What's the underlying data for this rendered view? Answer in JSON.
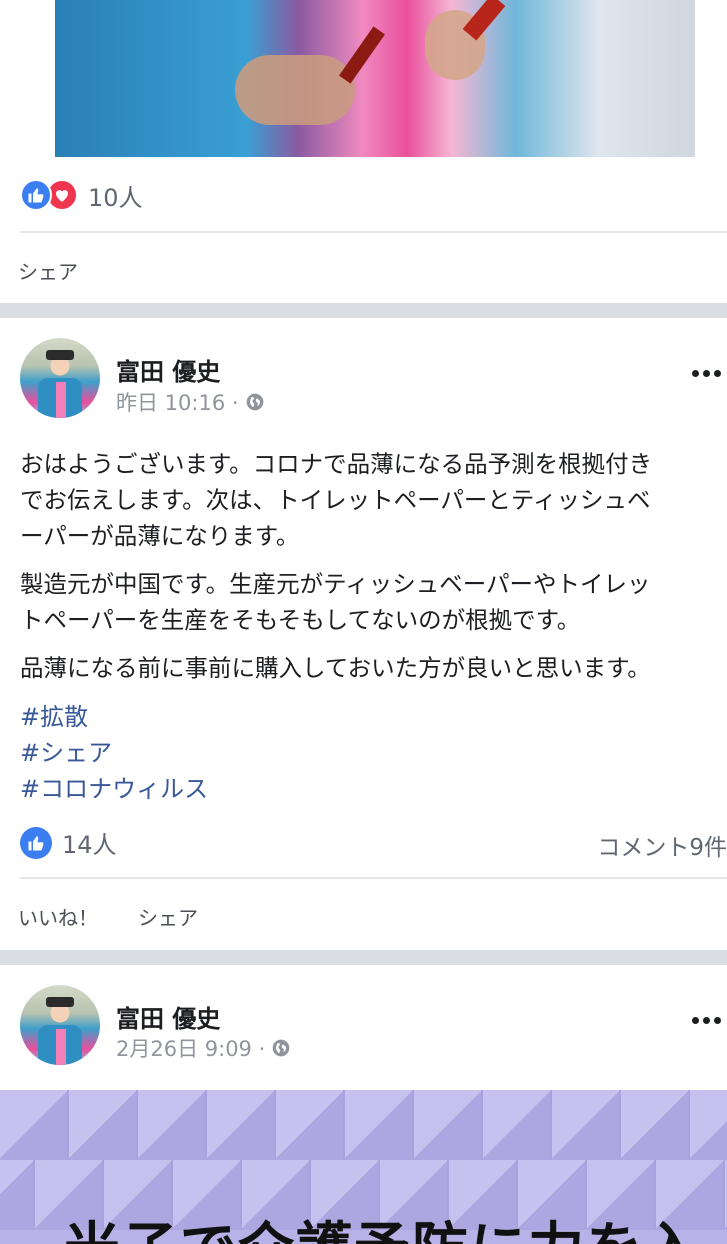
{
  "post_prev": {
    "reactions": [
      "like-icon",
      "love-icon"
    ],
    "reaction_count": "10人",
    "actions": {
      "share_label": "シェア"
    }
  },
  "post_main": {
    "author": "富田 優史",
    "time": "昨日 10:16 ·",
    "privacy_icon": "globe-icon",
    "paragraphs": [
      [
        "おはようございます。コロナで品薄になる品予測を根拠付き",
        "でお伝えします。次は、トイレットペーパーとティッシュベ",
        "ーパーが品薄になります。"
      ],
      [
        "製造元が中国です。生産元がティッシュベーパーやトイレッ",
        "トペーパーを生産をそもそもしてないのが根拠です。"
      ],
      [
        "品薄になる前に事前に購入しておいた方が良いと思います。"
      ]
    ],
    "hashtags": [
      "#拡散",
      "#シェア",
      "#コロナウィルス"
    ],
    "reactions": [
      "like-icon"
    ],
    "reaction_count": "14人",
    "comment_count": "コメント9件",
    "actions": {
      "like_label": "いいね！",
      "share_label": "シェア"
    }
  },
  "post_next": {
    "author": "富田 優史",
    "time": "2月26日 9:09 ·",
    "privacy_icon": "globe-icon",
    "image_text": "米子で介護予防に力を入"
  },
  "colors": {
    "like_blue": "#3b7ef0",
    "love_red": "#f0354f",
    "hashtag": "#385898",
    "meta_gray": "#90949c"
  }
}
